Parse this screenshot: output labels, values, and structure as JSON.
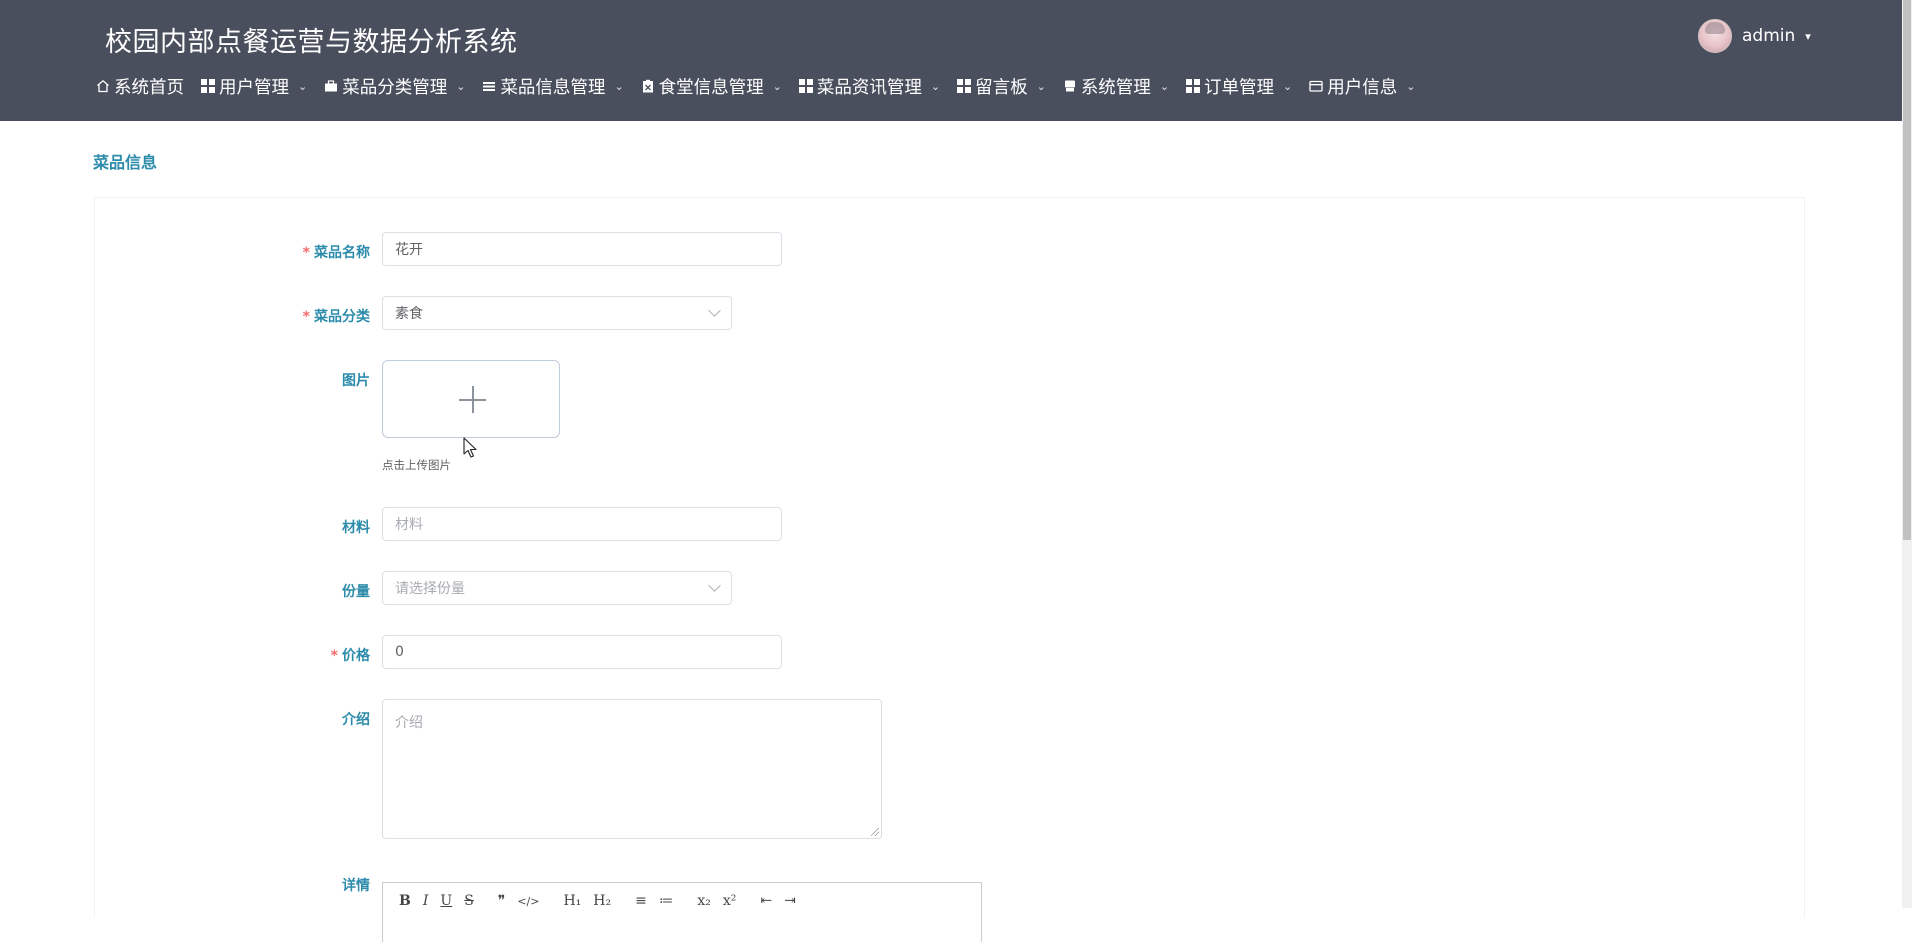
{
  "app": {
    "title": "校园内部点餐运营与数据分析系统"
  },
  "user": {
    "name": "admin",
    "caret": "▾"
  },
  "nav": [
    {
      "label": "系统首页",
      "icon": "home-icon"
    },
    {
      "label": "用户管理",
      "icon": "grid-icon"
    },
    {
      "label": "菜品分类管理",
      "icon": "briefcase-icon"
    },
    {
      "label": "菜品信息管理",
      "icon": "list-icon"
    },
    {
      "label": "食堂信息管理",
      "icon": "clipboard-icon"
    },
    {
      "label": "菜品资讯管理",
      "icon": "grid-icon"
    },
    {
      "label": "留言板",
      "icon": "grid-icon"
    },
    {
      "label": "系统管理",
      "icon": "printer-icon"
    },
    {
      "label": "订单管理",
      "icon": "grid-icon"
    },
    {
      "label": "用户信息",
      "icon": "card-icon"
    }
  ],
  "page": {
    "title": "菜品信息"
  },
  "form": {
    "name": {
      "label": "菜品名称",
      "required": "*",
      "value": "花开"
    },
    "category": {
      "label": "菜品分类",
      "required": "*",
      "value": "素食"
    },
    "image": {
      "label": "图片",
      "tip": "点击上传图片"
    },
    "material": {
      "label": "材料",
      "placeholder": "材料"
    },
    "portion": {
      "label": "份量",
      "placeholder": "请选择份量"
    },
    "price": {
      "label": "价格",
      "required": "*",
      "value": "0"
    },
    "intro": {
      "label": "介绍",
      "placeholder": "介绍"
    },
    "detail": {
      "label": "详情"
    }
  },
  "editor": {
    "tools": [
      "B",
      "I",
      "U",
      "S",
      "❞",
      "</>",
      "H₁",
      "H₂",
      "≡",
      "≔",
      "x₂",
      "x²",
      "⇤",
      "⇥"
    ]
  },
  "colors": {
    "header": "#4a4f5e",
    "accent": "#2d8cab",
    "required": "#f56c6c"
  }
}
